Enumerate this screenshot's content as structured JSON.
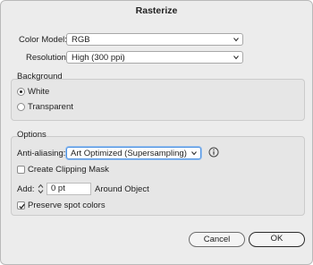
{
  "dialog": {
    "title": "Rasterize"
  },
  "color_model": {
    "label": "Color Model:",
    "value": "RGB"
  },
  "resolution": {
    "label": "Resolution:",
    "value": "High (300 ppi)"
  },
  "background": {
    "title": "Background",
    "options": [
      {
        "label": "White",
        "selected": true
      },
      {
        "label": "Transparent",
        "selected": false
      }
    ]
  },
  "options": {
    "title": "Options",
    "anti_aliasing_label": "Anti-aliasing:",
    "anti_aliasing_value": "Art Optimized (Supersampling)",
    "clipping_mask_label": "Create Clipping Mask",
    "clipping_mask_checked": false,
    "add_label": "Add:",
    "add_value": "0 pt",
    "around_object_label": "Around Object",
    "preserve_spot_label": "Preserve spot colors",
    "preserve_spot_checked": true
  },
  "buttons": {
    "cancel": "Cancel",
    "ok": "OK"
  },
  "icons": {
    "dropdown": "chevron-down-icon",
    "info": "info-icon",
    "stepper": "stepper-icon",
    "checkmark": "checkmark-icon"
  }
}
